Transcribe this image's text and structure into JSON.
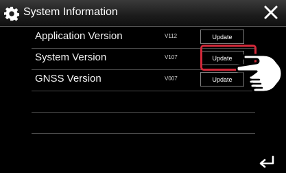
{
  "header": {
    "title": "System Information",
    "settings_icon": "gear-icon",
    "close_icon": "close-icon"
  },
  "rows": [
    {
      "name": "Application Version",
      "version": "V112",
      "button": "Update"
    },
    {
      "name": "System Version",
      "version": "V107",
      "button": "Update"
    },
    {
      "name": "GNSS Version",
      "version": "V007",
      "button": "Update"
    },
    {
      "name": "",
      "version": "",
      "button": ""
    },
    {
      "name": "",
      "version": "",
      "button": ""
    }
  ],
  "annotation": {
    "highlight_color": "#d4293a",
    "pointer_icon": "hand-pointer-icon"
  },
  "footer": {
    "back_icon": "back-arrow-icon"
  }
}
